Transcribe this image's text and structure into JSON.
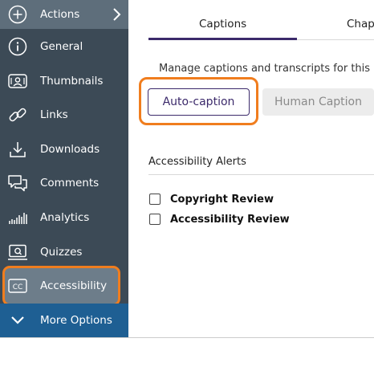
{
  "sidebar": {
    "actions": {
      "label": "Actions",
      "icon": "plus-circle-icon"
    },
    "items": [
      {
        "label": "General",
        "icon": "info-icon"
      },
      {
        "label": "Thumbnails",
        "icon": "thumbnails-icon"
      },
      {
        "label": "Links",
        "icon": "link-icon"
      },
      {
        "label": "Downloads",
        "icon": "download-icon"
      },
      {
        "label": "Comments",
        "icon": "comments-icon"
      },
      {
        "label": "Analytics",
        "icon": "analytics-icon"
      },
      {
        "label": "Quizzes",
        "icon": "quiz-icon"
      },
      {
        "label": "Accessibility",
        "icon": "closed-caption-icon",
        "active": true
      }
    ],
    "more": {
      "label": "More Options",
      "icon": "chevron-down-icon"
    }
  },
  "tabs": [
    {
      "label": "Captions",
      "active": true
    },
    {
      "label": "Chap"
    }
  ],
  "captions": {
    "description": "Manage captions and transcripts for this",
    "auto_caption_label": "Auto-caption",
    "human_caption_label": "Human Caption"
  },
  "alerts": {
    "title": "Accessibility Alerts",
    "items": [
      {
        "label": "Copyright Review",
        "checked": false
      },
      {
        "label": "Accessibility Review",
        "checked": false
      }
    ]
  },
  "colors": {
    "sidebar_bg": "#3c4a56",
    "active_item_bg": "#6d7d8a",
    "more_options_bg": "#1e5f93",
    "highlight": "#f07d1e",
    "accent": "#3c2a6b"
  }
}
